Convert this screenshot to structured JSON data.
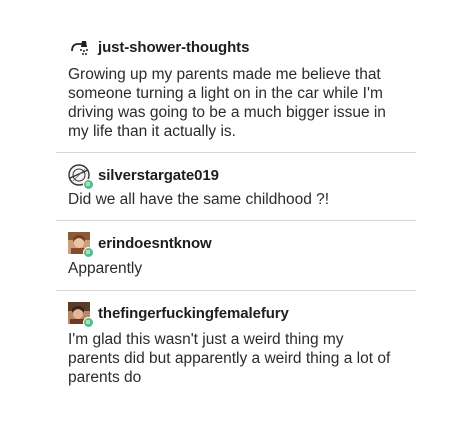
{
  "posts": [
    {
      "username": "just-shower-thoughts",
      "avatar_icon": "shower-head-icon",
      "reblog_badge": false,
      "text": "Growing up my parents made me believe that someone turning a light on in the car while I'm driving was going to be a much bigger issue in my life than it actually is."
    },
    {
      "username": "silverstargate019",
      "avatar_icon": "stargate-icon",
      "reblog_badge": true,
      "text": "Did we all have the same childhood ?!"
    },
    {
      "username": "erindoesntknow",
      "avatar_icon": "user-photo-icon",
      "reblog_badge": true,
      "text": "Apparently"
    },
    {
      "username": "thefingerfuckingfemalefury",
      "avatar_icon": "user-photo-icon",
      "reblog_badge": true,
      "text": "I'm glad this wasn't just a weird thing my parents did but apparently a weird thing a lot of parents do"
    }
  ],
  "colors": {
    "text": "#2b2b2b",
    "username": "#1e1e1e",
    "divider": "#d9d9d9",
    "reblog_badge": "#56bc8a"
  }
}
